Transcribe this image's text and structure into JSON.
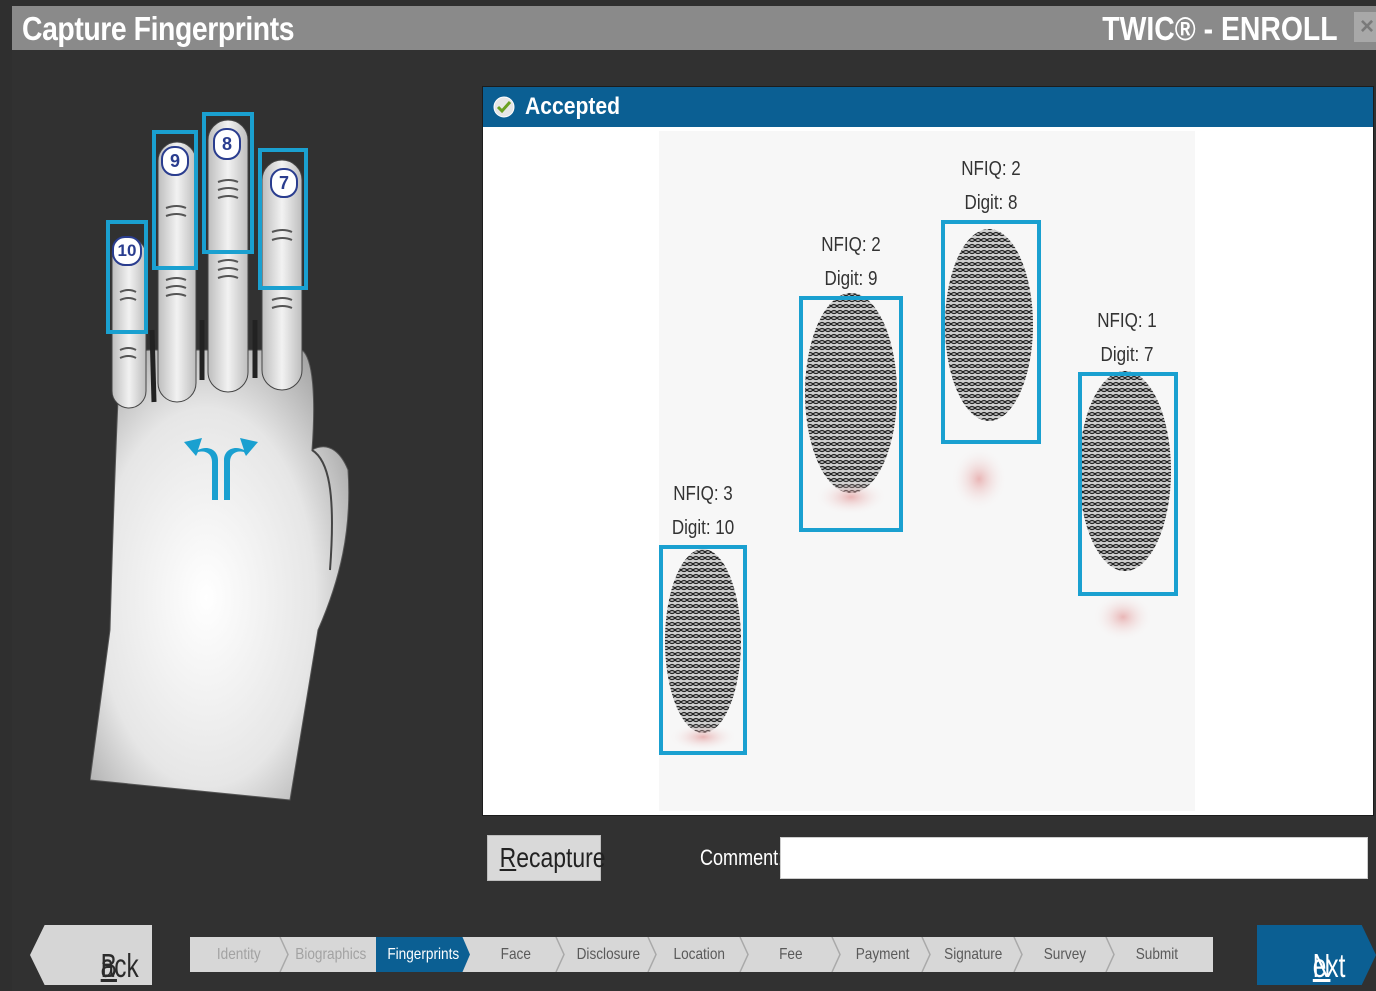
{
  "window": {
    "title": "Capture Fingerprints",
    "brand": "TWIC® - ENROLL",
    "close_label": "×"
  },
  "hand": {
    "fingers": [
      {
        "digit": "10"
      },
      {
        "digit": "9"
      },
      {
        "digit": "8"
      },
      {
        "digit": "7"
      }
    ]
  },
  "capture": {
    "status": "Accepted",
    "prints": [
      {
        "nfiq": "NFIQ: 3",
        "digit": "Digit: 10"
      },
      {
        "nfiq": "NFIQ: 2",
        "digit": "Digit: 9"
      },
      {
        "nfiq": "NFIQ: 2",
        "digit": "Digit: 8"
      },
      {
        "nfiq": "NFIQ: 1",
        "digit": "Digit: 7"
      }
    ]
  },
  "actions": {
    "recapture_first": "R",
    "recapture_rest": "ecapture",
    "comment_label": "Comment:",
    "comment_value": ""
  },
  "nav": {
    "back_first": "B",
    "back_rest": "ack",
    "next_first": "N",
    "next_rest": "ext",
    "steps": [
      {
        "label": "Identity",
        "state": "done"
      },
      {
        "label": "Biographics",
        "state": "done"
      },
      {
        "label": "Fingerprints",
        "state": "active"
      },
      {
        "label": "Face",
        "state": "todo"
      },
      {
        "label": "Disclosure",
        "state": "todo"
      },
      {
        "label": "Location",
        "state": "todo"
      },
      {
        "label": "Fee",
        "state": "todo"
      },
      {
        "label": "Payment",
        "state": "todo"
      },
      {
        "label": "Signature",
        "state": "todo"
      },
      {
        "label": "Survey",
        "state": "todo"
      },
      {
        "label": "Submit",
        "state": "todo"
      }
    ]
  },
  "colors": {
    "accent": "#0b5f93",
    "highlight": "#1aa0d0",
    "background": "#313131"
  }
}
